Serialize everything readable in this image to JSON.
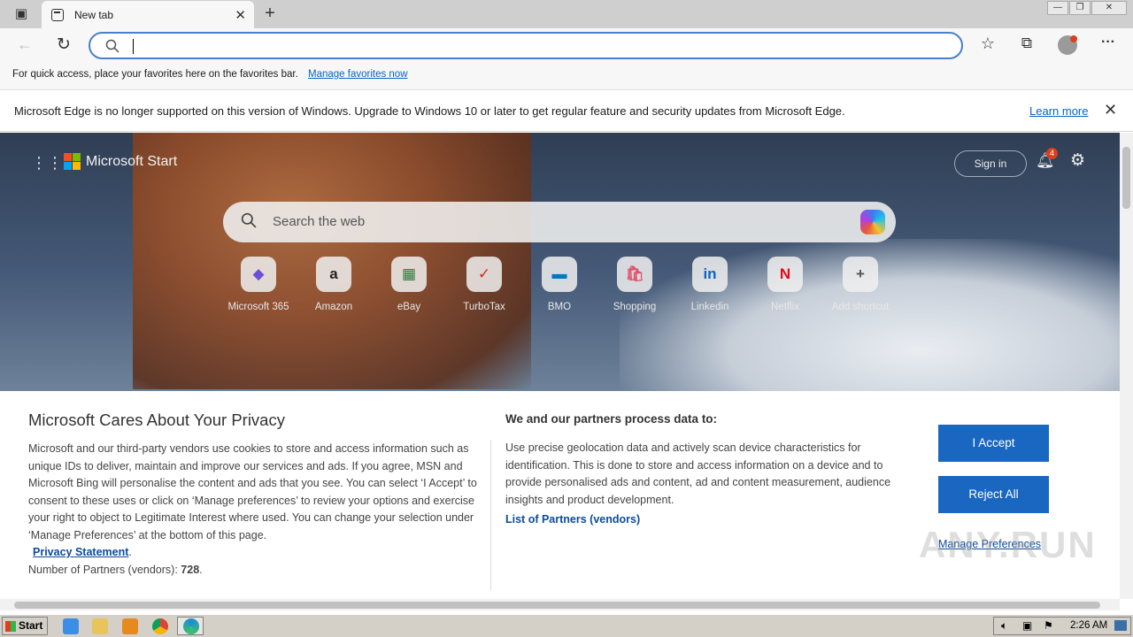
{
  "tab": {
    "title": "New tab",
    "close": "✕"
  },
  "toolbar": {
    "address_value": "",
    "back": "←",
    "refresh": "↻",
    "favorites": "☆",
    "collections": "⧉",
    "more": "···"
  },
  "favbar": {
    "message": "For quick access, place your favorites here on the favorites bar.",
    "link": "Manage favorites now"
  },
  "infobar": {
    "message": "Microsoft Edge is no longer supported on this version of Windows. Upgrade to Windows 10 or later to get regular feature and security updates from Microsoft Edge.",
    "link": "Learn more",
    "close": "✕"
  },
  "header": {
    "brand": "Microsoft Start",
    "signin": "Sign in",
    "notifications": "4"
  },
  "search": {
    "placeholder": "Search the web"
  },
  "shortcuts": [
    {
      "label": "Microsoft 365",
      "glyph": "◆",
      "color": "#6b4fd8"
    },
    {
      "label": "Amazon",
      "glyph": "a",
      "color": "#222222"
    },
    {
      "label": "eBay",
      "glyph": "▦",
      "color": "#2a7d3b"
    },
    {
      "label": "TurboTax",
      "glyph": "✓",
      "color": "#d52b1e"
    },
    {
      "label": "BMO",
      "glyph": "▬",
      "color": "#0079c1"
    },
    {
      "label": "Shopping",
      "glyph": "🛍",
      "color": "#e0526a"
    },
    {
      "label": "Linkedin",
      "glyph": "in",
      "color": "#0a66c2"
    },
    {
      "label": "Netflix",
      "glyph": "N",
      "color": "#e50914"
    },
    {
      "label": "Add shortcut",
      "glyph": "+",
      "color": "#555555"
    }
  ],
  "privacy": {
    "title": "Microsoft Cares About Your Privacy",
    "body": "Microsoft and our third-party vendors use cookies to store and access information such as unique IDs to deliver, maintain and improve our services and ads. If you agree, MSN and Microsoft Bing will personalise the content and ads that you see. You can select ‘I Accept’ to consent to these uses or click on ‘Manage preferences’ to review your options and exercise your right to object to Legitimate Interest where used.  You can change your selection under ‘Manage Preferences’ at the bottom of this page.",
    "privacy_link": "Privacy Statement",
    "partners_label": "Number of Partners (vendors):",
    "partners_count": "728",
    "right_title": "We and our partners process data to:",
    "right_body": "Use precise geolocation data and actively scan device characteristics for identification. This is done to store and access information on a device and to provide personalised ads and content, ad and content measurement, audience insights and product development.",
    "vendors_link": "List of Partners (vendors)",
    "accept": "I Accept",
    "reject": "Reject All",
    "manage": "Manage Preferences"
  },
  "watermark": "ANY.RUN",
  "taskbar": {
    "start": "Start",
    "clock": "2:26 AM"
  }
}
